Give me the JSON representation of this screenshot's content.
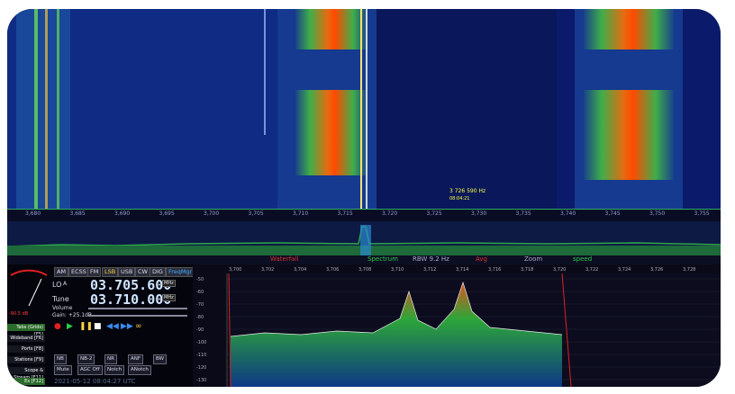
{
  "waterfall": {
    "marker_freq": "3 726 590 Hz",
    "marker_time": "08:04:21"
  },
  "freq_scale": [
    "3,680",
    "3,685",
    "3,690",
    "3,695",
    "3,700",
    "3,705",
    "3,710",
    "3,715",
    "3,720",
    "3,725",
    "3,730",
    "3,735",
    "3,740",
    "3,745",
    "3,750",
    "3,755"
  ],
  "modes": [
    "AM",
    "ECSS",
    "FM",
    "LSB",
    "USB",
    "CW",
    "DIG",
    "FreqMgr"
  ],
  "active_mode": "LSB",
  "lo": {
    "label": "LO",
    "sub": "A",
    "value": "03.705.600",
    "unit": "MHz"
  },
  "tune": {
    "label": "Tune",
    "value": "03.710.000",
    "unit": "MHz"
  },
  "volume_label": "Volume",
  "gain_label": "Gain: +25.1dB",
  "smeter": {
    "label": "S-meter",
    "value": "-90.5 dB"
  },
  "side_tabs": [
    "Tabs (Grids) [F5]",
    "Wideband [F6]",
    "Ports [F8]",
    "Stations [F9]",
    "Scope & Stream [F11]",
    "Ex [F12]"
  ],
  "function_buttons_row1": [
    "NB",
    "NB-2",
    "NR",
    "ANF",
    "BW"
  ],
  "function_buttons_row2": [
    "Mute",
    "AGC Off",
    "Notch",
    "ANotch"
  ],
  "timestamp": "2021-05-12 08:04:27 UTC",
  "toolbar": {
    "waterfall": "Waterfall",
    "spectrum": "Spectrum",
    "rbw": "RBW 9.2 Hz",
    "avg": "Avg",
    "zoom": "Zoom",
    "speed": "speed"
  },
  "spectrum_db": [
    "-50",
    "-60",
    "-70",
    "-80",
    "-90",
    "-100",
    "-110",
    "-120",
    "-130"
  ],
  "spectrum_freq": [
    "3,700",
    "3,702",
    "3,704",
    "3,706",
    "3,708",
    "3,710",
    "3,712",
    "3,714",
    "3,716",
    "3,718",
    "3,720",
    "3,722",
    "3,724",
    "3,726",
    "3,728"
  ],
  "colors": {
    "accent": "#ff6a00",
    "spectrum_fill": "#2fae3a",
    "lcd": "#cfe4ff"
  }
}
